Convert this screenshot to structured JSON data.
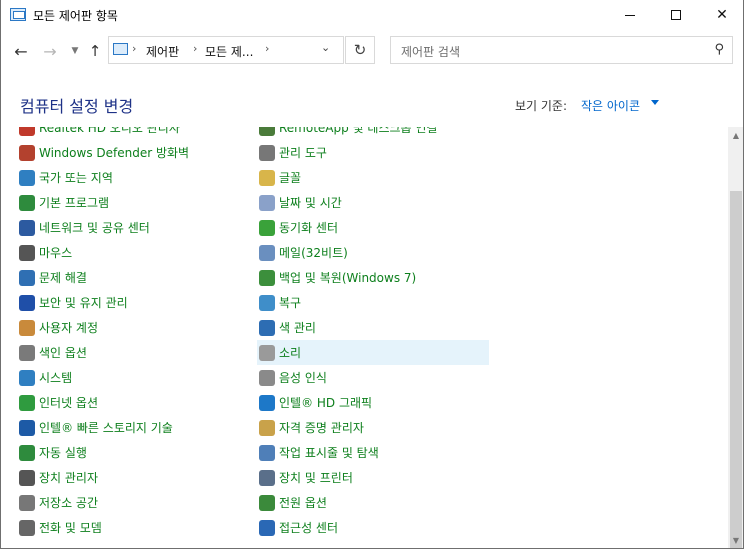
{
  "window": {
    "title": "모든 제어판 항목"
  },
  "address": {
    "segments": [
      "제어판",
      "모든 제..."
    ]
  },
  "search": {
    "placeholder": "제어판 검색"
  },
  "header": {
    "title": "컴퓨터 설정 변경",
    "view_by_label": "보기 기준:",
    "view_by_value": "작은 아이콘"
  },
  "left_items": [
    {
      "label": "Realtek HD 오디오 관리자",
      "icon": "speaker-icon",
      "color": "#c0392b"
    },
    {
      "label": "Windows Defender 방화벽",
      "icon": "firewall-icon",
      "color": "#b3412e"
    },
    {
      "label": "국가 또는 지역",
      "icon": "globe-icon",
      "color": "#2f7fc1"
    },
    {
      "label": "기본 프로그램",
      "icon": "default-programs-icon",
      "color": "#2e8b3d"
    },
    {
      "label": "네트워크 및 공유 센터",
      "icon": "network-icon",
      "color": "#2c5aa0"
    },
    {
      "label": "마우스",
      "icon": "mouse-icon",
      "color": "#555555"
    },
    {
      "label": "문제 해결",
      "icon": "troubleshoot-icon",
      "color": "#2f6fb3"
    },
    {
      "label": "보안 및 유지 관리",
      "icon": "flag-icon",
      "color": "#1f4fa8"
    },
    {
      "label": "사용자 계정",
      "icon": "users-icon",
      "color": "#c98a3b"
    },
    {
      "label": "색인 옵션",
      "icon": "indexing-icon",
      "color": "#7a7a7a"
    },
    {
      "label": "시스템",
      "icon": "system-icon",
      "color": "#2f7fc1"
    },
    {
      "label": "인터넷 옵션",
      "icon": "internet-icon",
      "color": "#2f9b3f"
    },
    {
      "label": "인텔® 빠른 스토리지 기술",
      "icon": "intel-storage-icon",
      "color": "#1d5aa6"
    },
    {
      "label": "자동 실행",
      "icon": "autoplay-icon",
      "color": "#2e8b3d"
    },
    {
      "label": "장치 관리자",
      "icon": "device-manager-icon",
      "color": "#555555"
    },
    {
      "label": "저장소 공간",
      "icon": "storage-icon",
      "color": "#777777"
    },
    {
      "label": "전화 및 모뎀",
      "icon": "phone-icon",
      "color": "#666666"
    }
  ],
  "right_items": [
    {
      "label": "RemoteApp 및 데스크톱 연결",
      "icon": "remoteapp-icon",
      "color": "#4a7b3a"
    },
    {
      "label": "관리 도구",
      "icon": "admin-tools-icon",
      "color": "#777777"
    },
    {
      "label": "글꼴",
      "icon": "fonts-icon",
      "color": "#d8b54a"
    },
    {
      "label": "날짜 및 시간",
      "icon": "clock-icon",
      "color": "#8aa1c9"
    },
    {
      "label": "동기화 센터",
      "icon": "sync-icon",
      "color": "#3aa23a"
    },
    {
      "label": "메일(32비트)",
      "icon": "mail-icon",
      "color": "#6a8fbf"
    },
    {
      "label": "백업 및 복원(Windows 7)",
      "icon": "backup-icon",
      "color": "#3c8f3c"
    },
    {
      "label": "복구",
      "icon": "recovery-icon",
      "color": "#3f8ec9"
    },
    {
      "label": "색 관리",
      "icon": "color-management-icon",
      "color": "#2d6db3"
    },
    {
      "label": "소리",
      "icon": "sound-icon",
      "color": "#9a9a9a"
    },
    {
      "label": "음성 인식",
      "icon": "microphone-icon",
      "color": "#8a8a8a"
    },
    {
      "label": "인텔® HD 그래픽",
      "icon": "intel-graphics-icon",
      "color": "#1d78c8"
    },
    {
      "label": "자격 증명 관리자",
      "icon": "credential-icon",
      "color": "#c9a24a"
    },
    {
      "label": "작업 표시줄 및 탐색",
      "icon": "taskbar-icon",
      "color": "#4f7fb8"
    },
    {
      "label": "장치 및 프린터",
      "icon": "printer-icon",
      "color": "#5a6f8a"
    },
    {
      "label": "전원 옵션",
      "icon": "power-icon",
      "color": "#3b8a3b"
    },
    {
      "label": "접근성 센터",
      "icon": "accessibility-icon",
      "color": "#2a68b5"
    }
  ],
  "hovered_item": "소리"
}
